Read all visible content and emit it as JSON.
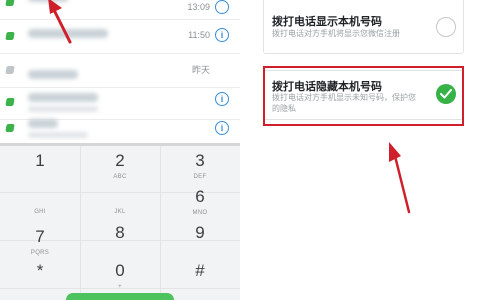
{
  "call_log": [
    {
      "time": "13:09",
      "info": ""
    },
    {
      "time": "11:50",
      "info": "i"
    },
    {
      "time": "昨天",
      "info": ""
    },
    {
      "time": "",
      "info": "i"
    },
    {
      "time": "",
      "info": "i"
    }
  ],
  "dialpad": {
    "keys": [
      {
        "num": "1",
        "sub": ""
      },
      {
        "num": "2",
        "sub": "ABC"
      },
      {
        "num": "3",
        "sub": "DEF"
      },
      {
        "num": "",
        "sub": "GHI"
      },
      {
        "num": "",
        "sub": "JKL"
      },
      {
        "num": "6",
        "sub": "MNO"
      },
      {
        "num": "7",
        "sub": "PQRS"
      },
      {
        "num": "8",
        "sub": ""
      },
      {
        "num": "9",
        "sub": ""
      },
      {
        "num": "*",
        "sub": ""
      },
      {
        "num": "0",
        "sub": "+"
      },
      {
        "num": "#",
        "sub": ""
      }
    ]
  },
  "caller_id_options": {
    "show_number": {
      "title": "拨打电话显示本机号码",
      "desc": "拨打电话对方手机将显示您微信注册"
    },
    "hide_number": {
      "title": "拨打电话隐藏本机号码",
      "desc": "拨打电话对方手机显示未知号码，保护您的隐私",
      "selected": true
    }
  },
  "colors": {
    "highlight": "#cf1f2a",
    "accent_green": "#36b247",
    "info_blue": "#3a8fd8"
  }
}
